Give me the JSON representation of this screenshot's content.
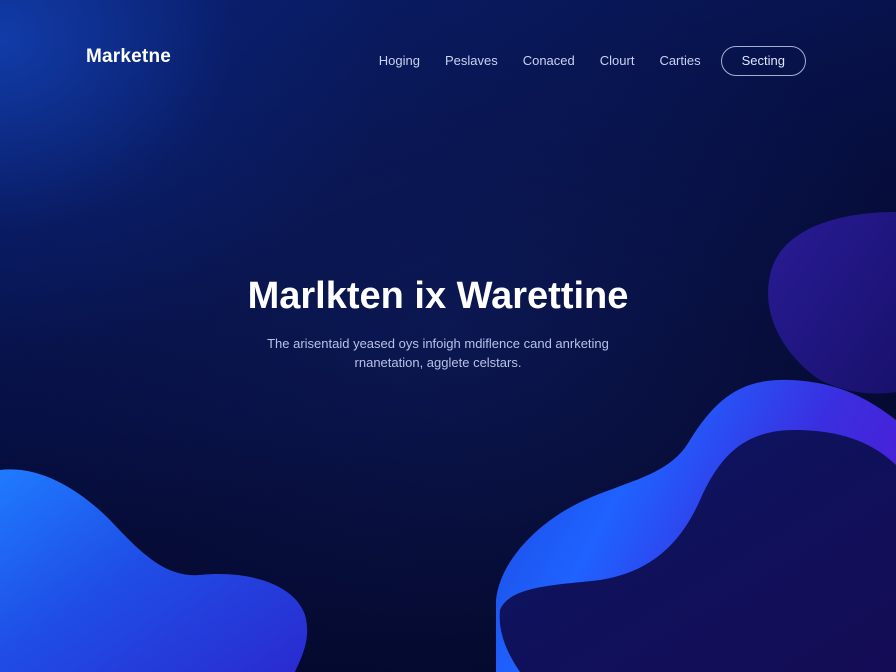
{
  "brand": {
    "name": "Marketne"
  },
  "nav": {
    "links": [
      "Hoging",
      "Peslaves",
      "Conaced",
      "Clourt",
      "Carties"
    ],
    "cta_label": "Secting"
  },
  "hero": {
    "title": "Marlkten ix Warettine",
    "subtitle": "The arisentaid yeased oys infoigh mdiflence cand anrketing rnanetation, agglete celstars."
  },
  "colors": {
    "background": "#050a2e",
    "accent_blue": "#1e5cff",
    "accent_violet": "#3a1fd6",
    "text_primary": "#ffffff",
    "text_muted": "#b8c2e6"
  }
}
